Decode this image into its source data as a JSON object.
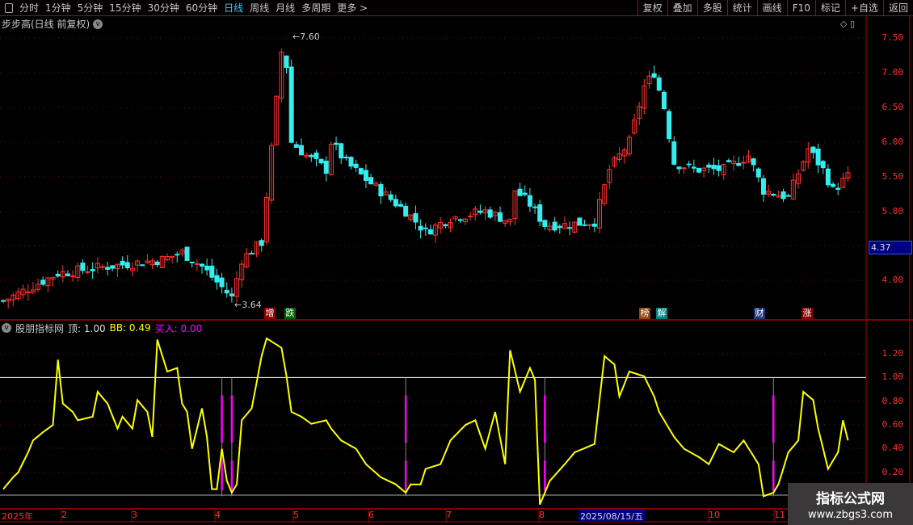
{
  "toolbar": {
    "periods": [
      "分时",
      "1分钟",
      "5分钟",
      "15分钟",
      "30分钟",
      "60分钟",
      "日线",
      "周线",
      "月线",
      "多周期",
      "更多 >"
    ],
    "active": "日线",
    "right": [
      "复权",
      "叠加",
      "多股",
      "统计",
      "画线",
      "F10",
      "标记",
      "+自选",
      "返回"
    ]
  },
  "main": {
    "title": "步步高(日线 前复权)",
    "high_label": "7.60",
    "low_label": "3.64",
    "price_tag": "4.37",
    "y_ticks": [
      "7.50",
      "7.00",
      "6.50",
      "6.00",
      "5.50",
      "5.00",
      "4.00"
    ],
    "badges": [
      {
        "text": "增",
        "color": "#8b0000"
      },
      {
        "text": "跌",
        "color": "#006400"
      },
      {
        "text": "榜",
        "color": "#8b4513"
      },
      {
        "text": "解",
        "color": "#008080"
      },
      {
        "text": "财",
        "color": "#1a3a7a"
      },
      {
        "text": "涨",
        "color": "#8b0000"
      }
    ]
  },
  "indicator": {
    "name": "股朋指标网",
    "top_label": "顶: 1.00",
    "bb_label": "BB: 0.49",
    "buy_label": "买入: 0.00",
    "y_ticks": [
      "1.20",
      "1.00",
      "0.80",
      "0.60",
      "0.40",
      "0.20"
    ]
  },
  "xaxis": {
    "labels": [
      "2025年",
      "2",
      "3",
      "4",
      "5",
      "6",
      "7",
      "8",
      "10",
      "11"
    ],
    "cursor_date": "2025/08/15/五"
  },
  "watermark": {
    "line1": "指标公式网",
    "line2": "www.zbgs3.com"
  },
  "colors": {
    "up": "#ff3030",
    "down": "#33eeee",
    "line": "#ffff00",
    "buy": "#ff00ff"
  },
  "chart_data": {
    "type": "line",
    "price_path": [
      [
        0,
        3.7
      ],
      [
        11,
        4.1
      ],
      [
        21,
        4.2
      ],
      [
        32,
        4.3
      ],
      [
        36,
        4.4
      ],
      [
        40,
        4.2
      ],
      [
        46,
        3.75
      ],
      [
        48,
        4.3
      ],
      [
        52,
        4.55
      ],
      [
        54,
        5.9
      ],
      [
        56,
        7.3
      ],
      [
        57,
        7.1
      ],
      [
        58,
        6.0
      ],
      [
        61,
        5.8
      ],
      [
        65,
        5.6
      ],
      [
        66,
        6.0
      ],
      [
        69,
        5.7
      ],
      [
        74,
        5.4
      ],
      [
        81,
        5.0
      ],
      [
        85,
        4.7
      ],
      [
        90,
        4.9
      ],
      [
        97,
        5.0
      ],
      [
        102,
        4.85
      ],
      [
        103,
        5.3
      ],
      [
        106,
        5.1
      ],
      [
        109,
        4.8
      ],
      [
        113,
        4.8
      ],
      [
        119,
        4.85
      ],
      [
        122,
        5.6
      ],
      [
        126,
        6.0
      ],
      [
        129,
        6.8
      ],
      [
        131,
        7.0
      ],
      [
        133,
        6.5
      ],
      [
        135,
        5.7
      ],
      [
        139,
        5.6
      ],
      [
        145,
        5.6
      ],
      [
        150,
        5.8
      ],
      [
        153,
        5.3
      ],
      [
        158,
        5.2
      ],
      [
        162,
        5.9
      ],
      [
        165,
        5.6
      ],
      [
        167,
        5.3
      ],
      [
        170,
        5.5
      ]
    ],
    "indicator_bb": [
      [
        0,
        0.06
      ],
      [
        2,
        0.16
      ],
      [
        3,
        0.2
      ],
      [
        5,
        0.37
      ],
      [
        6,
        0.47
      ],
      [
        8,
        0.54
      ],
      [
        10,
        0.6
      ],
      [
        11,
        1.15
      ],
      [
        12,
        0.78
      ],
      [
        14,
        0.71
      ],
      [
        15,
        0.64
      ],
      [
        18,
        0.67
      ],
      [
        19,
        0.88
      ],
      [
        21,
        0.78
      ],
      [
        23,
        0.57
      ],
      [
        24,
        0.67
      ],
      [
        26,
        0.57
      ],
      [
        27,
        0.81
      ],
      [
        29,
        0.71
      ],
      [
        30,
        0.5
      ],
      [
        31,
        1.32
      ],
      [
        33,
        1.05
      ],
      [
        35,
        1.08
      ],
      [
        36,
        0.78
      ],
      [
        37,
        0.71
      ],
      [
        38,
        0.4
      ],
      [
        40,
        0.74
      ],
      [
        41,
        0.5
      ],
      [
        42,
        0.06
      ],
      [
        43,
        0.06
      ],
      [
        44,
        0.4
      ],
      [
        45,
        0.13
      ],
      [
        46,
        0.03
      ],
      [
        47,
        0.1
      ],
      [
        48,
        0.64
      ],
      [
        50,
        0.74
      ],
      [
        52,
        1.18
      ],
      [
        53,
        1.33
      ],
      [
        56,
        1.25
      ],
      [
        57,
        1.01
      ],
      [
        58,
        0.71
      ],
      [
        60,
        0.67
      ],
      [
        62,
        0.61
      ],
      [
        65,
        0.64
      ],
      [
        66,
        0.57
      ],
      [
        68,
        0.47
      ],
      [
        71,
        0.4
      ],
      [
        73,
        0.27
      ],
      [
        76,
        0.16
      ],
      [
        79,
        0.1
      ],
      [
        81,
        0.03
      ],
      [
        82,
        0.1
      ],
      [
        84,
        0.1
      ],
      [
        85,
        0.23
      ],
      [
        88,
        0.27
      ],
      [
        90,
        0.47
      ],
      [
        93,
        0.6
      ],
      [
        95,
        0.64
      ],
      [
        97,
        0.4
      ],
      [
        99,
        0.71
      ],
      [
        101,
        0.27
      ],
      [
        102,
        1.23
      ],
      [
        104,
        0.88
      ],
      [
        106,
        1.08
      ],
      [
        107,
        0.98
      ],
      [
        108,
        -0.07
      ],
      [
        110,
        0.13
      ],
      [
        113,
        0.27
      ],
      [
        115,
        0.37
      ],
      [
        119,
        0.44
      ],
      [
        121,
        1.18
      ],
      [
        123,
        1.11
      ],
      [
        124,
        0.84
      ],
      [
        126,
        1.05
      ],
      [
        129,
        1.01
      ],
      [
        131,
        0.84
      ],
      [
        132,
        0.71
      ],
      [
        135,
        0.5
      ],
      [
        137,
        0.4
      ],
      [
        140,
        0.33
      ],
      [
        142,
        0.27
      ],
      [
        144,
        0.44
      ],
      [
        147,
        0.37
      ],
      [
        149,
        0.47
      ],
      [
        152,
        0.27
      ],
      [
        153,
        0.0
      ],
      [
        155,
        0.03
      ],
      [
        156,
        0.1
      ],
      [
        158,
        0.37
      ],
      [
        160,
        0.47
      ],
      [
        161,
        0.88
      ],
      [
        163,
        0.81
      ],
      [
        164,
        0.57
      ],
      [
        166,
        0.23
      ],
      [
        168,
        0.37
      ],
      [
        169,
        0.64
      ],
      [
        170,
        0.47
      ]
    ],
    "buy_signals": [
      44,
      46,
      81,
      109,
      155
    ],
    "ylim_price": [
      3.5,
      7.7
    ],
    "ylim_indicator": [
      -0.1,
      1.45
    ],
    "reference_line": 1.0
  }
}
